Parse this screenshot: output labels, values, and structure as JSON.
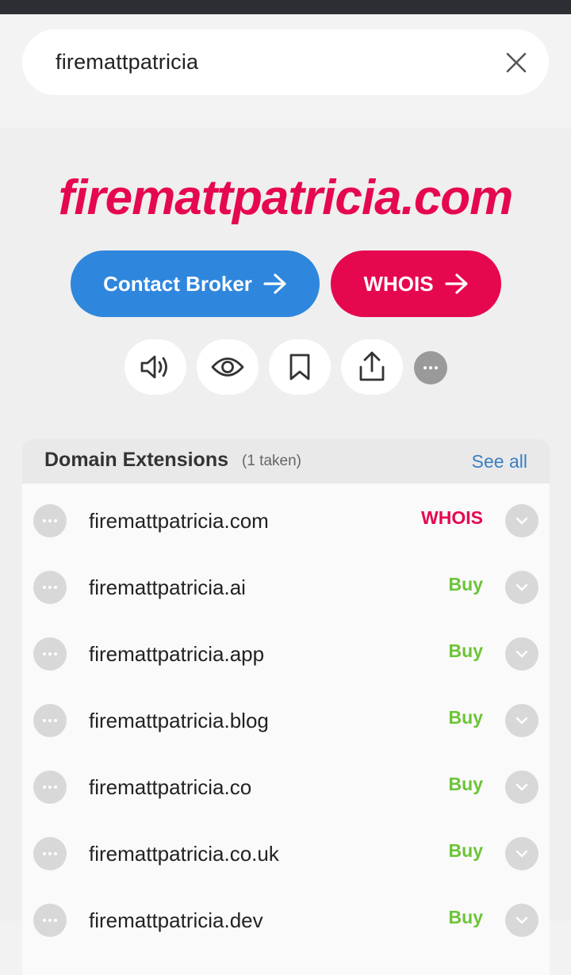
{
  "search": {
    "query": "firemattpatricia"
  },
  "domain": {
    "name": "firemattpatricia.com"
  },
  "actions": {
    "contact_broker": "Contact Broker",
    "whois": "WHOIS"
  },
  "icons": [
    "speaker-icon",
    "eye-icon",
    "bookmark-icon",
    "share-icon",
    "more-icon"
  ],
  "extensions": {
    "title": "Domain Extensions",
    "taken_count": "(1 taken)",
    "see_all": "See all",
    "rows": [
      {
        "name": "firemattpatricia.com",
        "action": "WHOIS"
      },
      {
        "name": "firemattpatricia.ai",
        "action": "Buy"
      },
      {
        "name": "firemattpatricia.app",
        "action": "Buy"
      },
      {
        "name": "firemattpatricia.blog",
        "action": "Buy"
      },
      {
        "name": "firemattpatricia.co",
        "action": "Buy"
      },
      {
        "name": "firemattpatricia.co.uk",
        "action": "Buy"
      },
      {
        "name": "firemattpatricia.dev",
        "action": "Buy"
      }
    ]
  },
  "colors": {
    "brand_pink": "#e6084f",
    "broker_blue": "#2f86dd",
    "buy_green": "#6cc437",
    "link_blue": "#3a7fc4"
  }
}
